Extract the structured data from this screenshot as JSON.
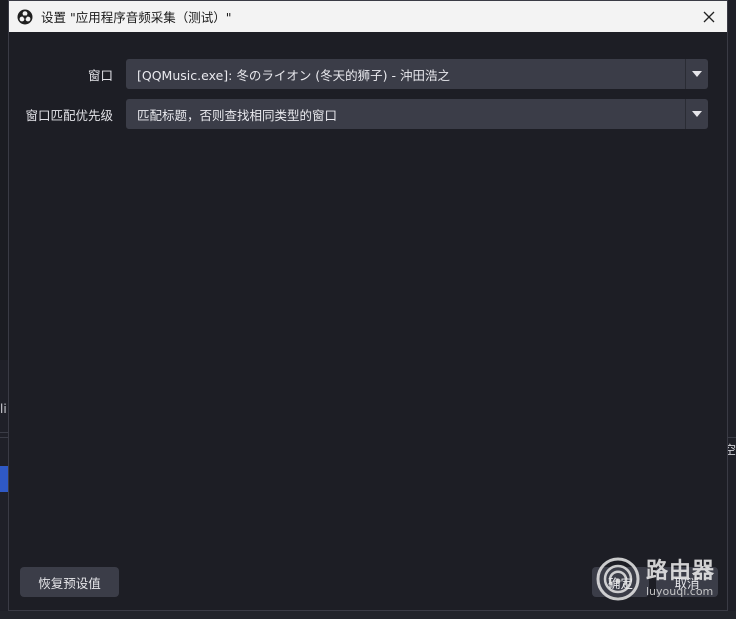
{
  "dialog": {
    "title": "设置 \"应用程序音频采集（测试）\""
  },
  "form": {
    "window": {
      "label": "窗口",
      "value": "[QQMusic.exe]: 冬のライオン (冬天的狮子) - 沖田浩之"
    },
    "match_priority": {
      "label": "窗口匹配优先级",
      "value": "匹配标题，否则查找相同类型的窗口"
    }
  },
  "buttons": {
    "defaults": "恢复预设值",
    "ok": "确定",
    "cancel": "取消"
  },
  "background": {
    "left_text": "li",
    "right_text": "空"
  },
  "watermark": {
    "main": "路由器",
    "sub": "luyouqi.com"
  },
  "icons": {
    "app": "obs-logo-icon",
    "close": "close-icon",
    "dropdown": "chevron-down-icon"
  }
}
